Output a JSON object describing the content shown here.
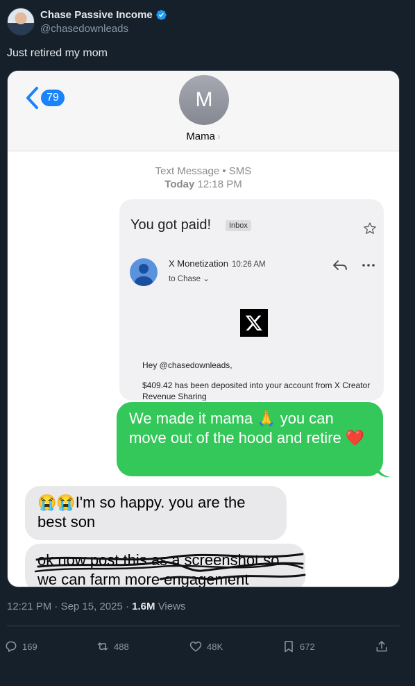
{
  "author": {
    "name": "Chase Passive Income",
    "handle": "@chasedownleads",
    "verified_icon": "verified-badge-icon",
    "verified_color": "#1d9bf0"
  },
  "tweet": {
    "text": "Just retired my mom",
    "time": "12:21 PM",
    "date": "Sep 15, 2025",
    "views_count": "1.6M",
    "views_label": "Views"
  },
  "imessage": {
    "unread_count": "79",
    "contact_initial": "M",
    "contact_name": "Mama",
    "service_line": "Text Message • SMS",
    "day": "Today",
    "time": "12:18 PM"
  },
  "email": {
    "subject": "You got paid!",
    "label": "Inbox",
    "sender": "X Monetization",
    "sent_time": "10:26 AM",
    "to_line": "to Chase",
    "greeting": "Hey @chasedownleads,",
    "body": "$409.42 has been deposited into your account from X Creator Revenue Sharing"
  },
  "messages": {
    "sent_1": "We made it mama 🙏 you can move out of the hood and retire ❤️",
    "received_1": "😭😭I'm so happy. you are the best son",
    "received_2": "ok now post this as a screenshot so we can farm more engagement"
  },
  "actions": {
    "replies": "169",
    "reposts": "488",
    "likes": "48K",
    "bookmarks": "672"
  },
  "colors": {
    "background": "#15202b",
    "sent_bubble": "#34c759",
    "received_bubble": "#e9e9eb",
    "ios_blue": "#1a82fb"
  }
}
